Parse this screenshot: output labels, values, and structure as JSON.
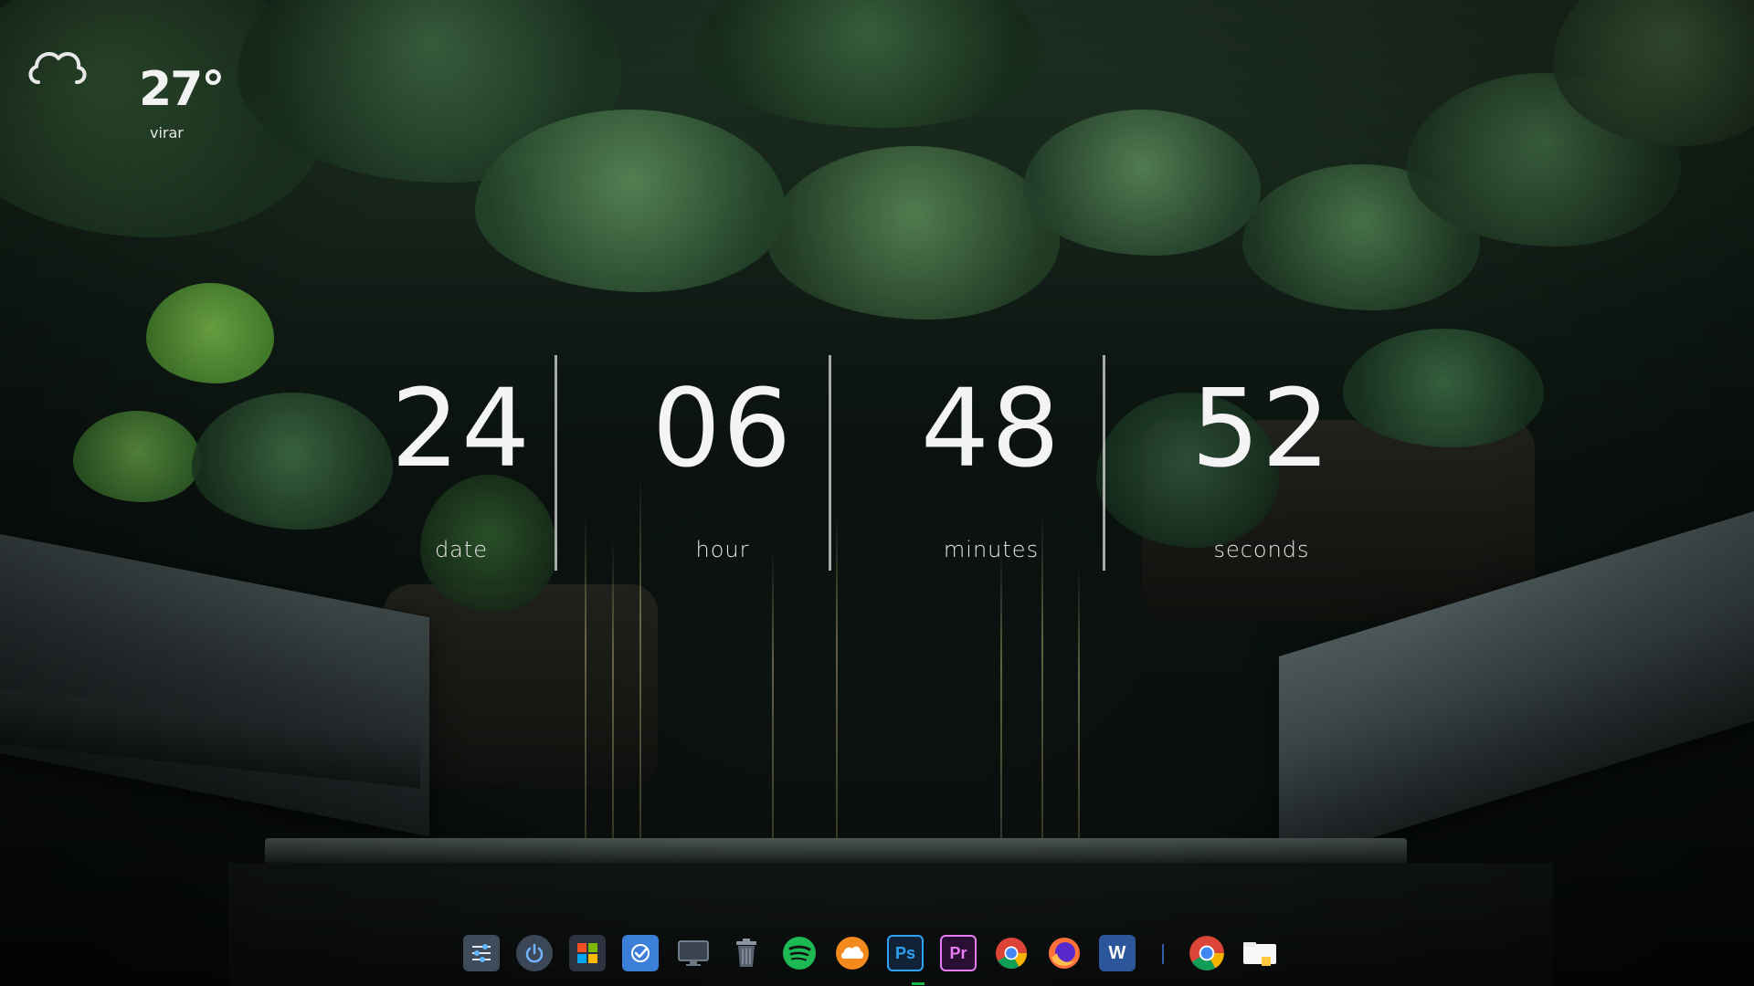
{
  "weather": {
    "temperature": "27°",
    "location": "virar",
    "icon": "cloud-icon"
  },
  "clock": {
    "columns": [
      {
        "value": "24",
        "label": "date"
      },
      {
        "value": "06",
        "label": "hour"
      },
      {
        "value": "48",
        "label": "minutes"
      },
      {
        "value": "52",
        "label": "seconds"
      }
    ]
  },
  "dock": {
    "items": [
      {
        "name": "settings-sliders-icon"
      },
      {
        "name": "power-icon"
      },
      {
        "name": "windows-store-icon"
      },
      {
        "name": "tasks-checkmark-icon"
      },
      {
        "name": "monitor-icon"
      },
      {
        "name": "trash-icon"
      },
      {
        "name": "spotify-icon"
      },
      {
        "name": "cloud-sync-icon"
      },
      {
        "name": "photoshop-icon",
        "text": "Ps"
      },
      {
        "name": "premiere-icon",
        "text": "Pr"
      },
      {
        "name": "chrome-icon"
      },
      {
        "name": "firefox-icon"
      },
      {
        "name": "word-icon",
        "text": "W"
      },
      {
        "name": "chrome-icon-pinned"
      },
      {
        "name": "file-explorer-icon"
      }
    ]
  },
  "colors": {
    "clock_text": "#f4f4f4",
    "dock_separator": "#2e5fa6",
    "spotify": "#1db954",
    "photoshop": "#2fa3f7",
    "premiere": "#e77cf3"
  }
}
